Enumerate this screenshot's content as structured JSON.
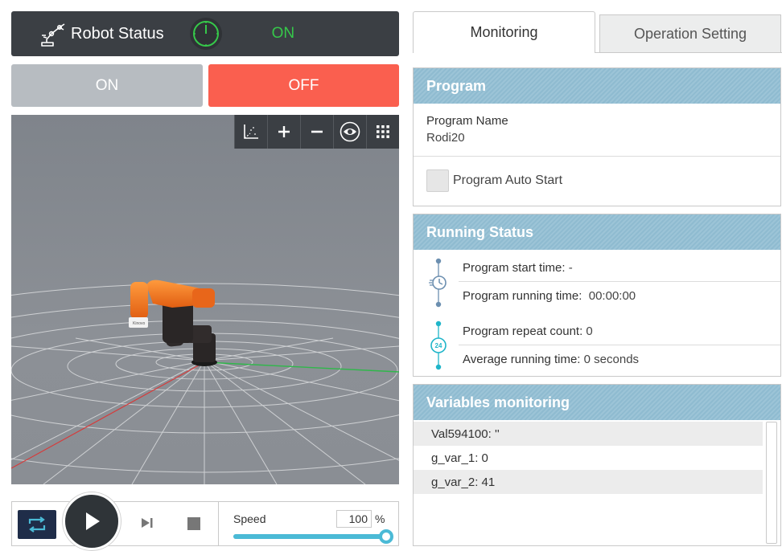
{
  "status": {
    "title": "Robot Status",
    "state": "ON",
    "state_color": "#36c84a"
  },
  "power": {
    "on_label": "ON",
    "off_label": "OFF"
  },
  "viewer": {
    "tools": [
      "axes-icon",
      "zoom-in-icon",
      "zoom-out-icon",
      "eye-icon",
      "grid-menu-icon"
    ],
    "tool_labels": [
      "",
      "+",
      "−",
      "",
      ""
    ],
    "gripper_label": "Kinovo"
  },
  "controls": {
    "speed_label": "Speed",
    "speed_value": "100",
    "speed_unit": "%",
    "speed_fraction": 1.0
  },
  "tabs": [
    {
      "label": "Monitoring",
      "active": true
    },
    {
      "label": "Operation Setting",
      "active": false
    }
  ],
  "program": {
    "heading": "Program",
    "name_label": "Program Name",
    "name_value": "Rodi20",
    "auto_start_label": "Program Auto Start",
    "auto_start_checked": false
  },
  "running": {
    "heading": "Running Status",
    "start_time_label": "Program start time:",
    "start_time_value": "-",
    "running_time_label": "Program running time:",
    "running_time_value": "00:00:00",
    "repeat_count_label": "Program repeat count:",
    "repeat_count_value": "0",
    "avg_time_label": "Average running time:",
    "avg_time_value": "0 seconds"
  },
  "variables": {
    "heading": "Variables monitoring",
    "rows": [
      {
        "name": "Val594100:",
        "value": "''"
      },
      {
        "name": "g_var_1:",
        "value": "0"
      },
      {
        "name": "g_var_2:",
        "value": "41"
      }
    ]
  },
  "colors": {
    "off": "#fa5f4f",
    "on": "#b7bcc1",
    "panel_header": "#8fbbd0",
    "accent": "#4bbad6",
    "dark": "#3b3f44"
  }
}
